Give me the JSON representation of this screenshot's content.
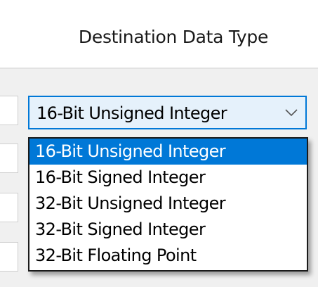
{
  "column_header": {
    "title": "Destination Data Type"
  },
  "combo": {
    "value": "16-Bit Unsigned Integer",
    "icon": "chevron-down-icon"
  },
  "dropdown": {
    "options": [
      {
        "label": "16-Bit Unsigned Integer",
        "selected": true
      },
      {
        "label": "16-Bit Signed Integer",
        "selected": false
      },
      {
        "label": "32-Bit Unsigned Integer",
        "selected": false
      },
      {
        "label": "32-Bit Signed Integer",
        "selected": false
      },
      {
        "label": "32-Bit Floating Point",
        "selected": false
      }
    ]
  },
  "colors": {
    "accent": "#0078d7",
    "combo_background": "#e5f1fb",
    "selected_text": "#ffffff"
  }
}
